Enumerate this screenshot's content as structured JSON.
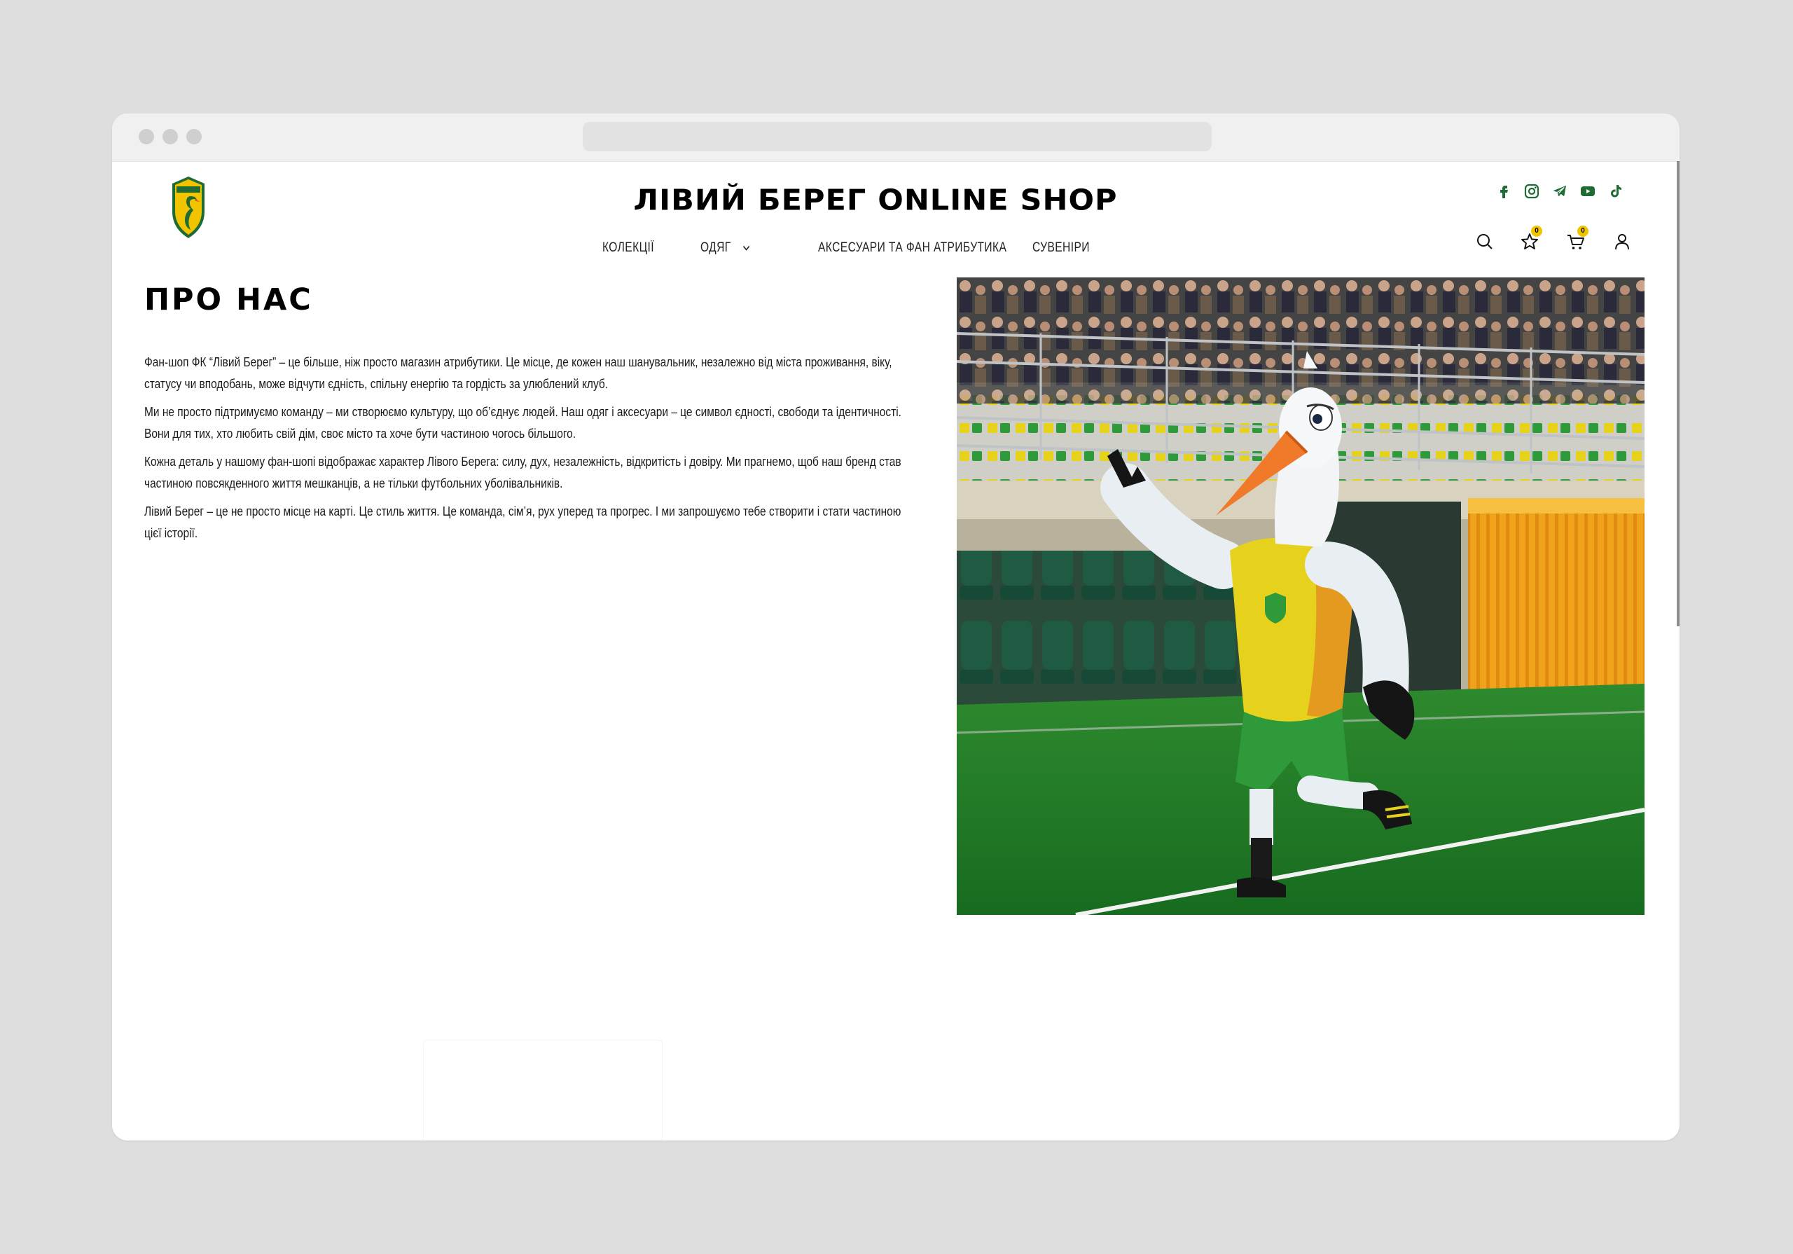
{
  "site": {
    "title": "ЛІВИЙ БЕРЕГ ONLINE SHOP",
    "brand_colors": {
      "green": "#1f6b34",
      "yellow": "#f2c400",
      "black": "#000000"
    }
  },
  "socials": [
    {
      "name": "facebook-icon"
    },
    {
      "name": "instagram-icon"
    },
    {
      "name": "telegram-icon"
    },
    {
      "name": "youtube-icon"
    },
    {
      "name": "tiktok-icon"
    }
  ],
  "nav": {
    "items": [
      {
        "label": "КОЛЕКЦІЇ"
      },
      {
        "label": "ОДЯГ"
      },
      {
        "label": "АКСЕСУАРИ ТА ФАН АТРИБУТИКА"
      },
      {
        "label": "СУВЕНІРИ"
      }
    ]
  },
  "tools": {
    "wishlist_count": "0",
    "cart_count": "0"
  },
  "page": {
    "title": "ПРО НАС",
    "paragraphs": [
      "Фан-шоп ФК “Лівий Берег” – це більше, ніж просто магазин атрибутики. Це місце, де кожен наш шанувальник, незалежно від міста проживання, віку, статусу чи вподобань, може відчути єдність, спільну енергію та гордість за улюблений клуб.",
      "Ми не просто підтримуємо команду – ми створюємо культуру, що об’єднує людей. Наш одяг і аксесуари – це символ єдності, свободи та ідентичності. Вони для тих, хто любить свій дім, своє місто та хоче бути частиною чогось більшого.",
      "Кожна деталь у нашому фан-шопі відображає характер Лівого Берега: силу, дух, незалежність, відкритість і довіру. Ми прагнемо, щоб наш бренд став частиною повсякденного життя мешканців, а не тільки футбольних уболівальників.",
      "Лівий Берег – це не просто місце на карті. Це стиль життя. Це команда, сім’я, рух уперед та прогрес. І ми запрошуємо тебе створити і стати частиною цієї історії."
    ]
  }
}
